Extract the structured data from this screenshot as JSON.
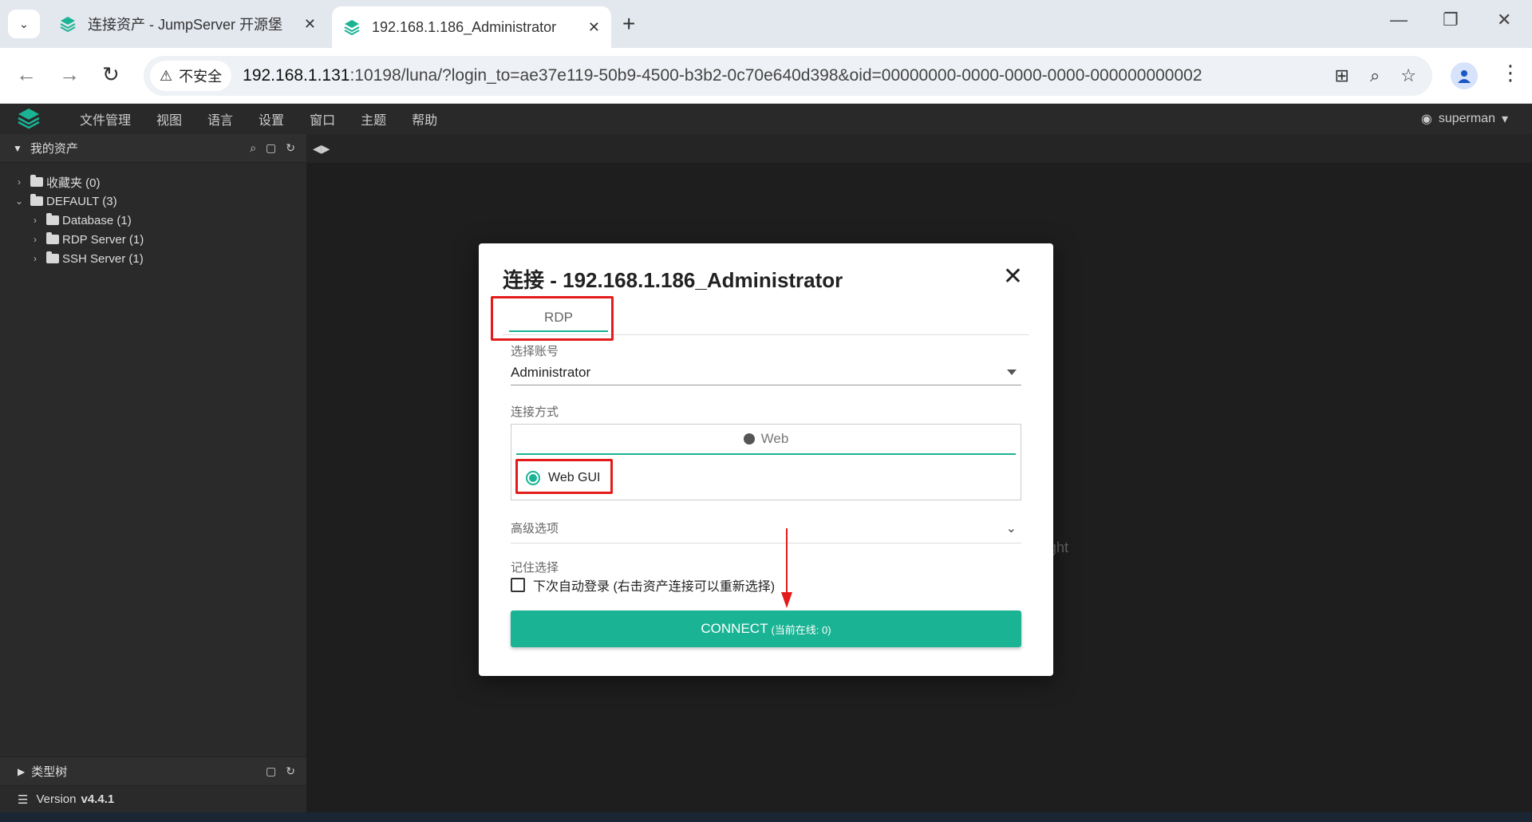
{
  "browser": {
    "tabs": [
      {
        "title": "连接资产 - JumpServer 开源堡",
        "active": false
      },
      {
        "title": "192.168.1.186_Administrator",
        "active": true
      }
    ],
    "security_label": "不安全",
    "url_host": "192.168.1.131",
    "url_rest": ":10198/luna/?login_to=ae37e119-50b9-4500-b3b2-0c70e640d398&oid=00000000-0000-0000-0000-000000000002"
  },
  "menubar": {
    "items": [
      "文件管理",
      "视图",
      "语言",
      "设置",
      "窗口",
      "主题",
      "帮助"
    ],
    "user": "superman"
  },
  "sidebar": {
    "header": "我的资产",
    "tree": [
      {
        "label": "收藏夹 (0)",
        "level": 0,
        "expanded": false
      },
      {
        "label": "DEFAULT (3)",
        "level": 0,
        "expanded": true
      },
      {
        "label": "Database (1)",
        "level": 1,
        "expanded": false
      },
      {
        "label": "RDP Server (1)",
        "level": 1,
        "expanded": false
      },
      {
        "label": "SSH Server (1)",
        "level": 1,
        "expanded": false
      }
    ],
    "type_tree_label": "类型树",
    "version_label": "Version",
    "version": "v4.4.1"
  },
  "main": {
    "bg_text": "ght"
  },
  "dialog": {
    "title": "连接 - 192.168.1.186_Administrator",
    "protocol_tab": "RDP",
    "account_label": "选择账号",
    "account_value": "Administrator",
    "method_label": "连接方式",
    "method_tab": "Web",
    "method_option": "Web GUI",
    "advanced_label": "高级选项",
    "remember_label": "记住选择",
    "auto_login_label": "下次自动登录 (右击资产连接可以重新选择)",
    "connect_label": "CONNECT",
    "connect_sub": "(当前在线: 0)"
  },
  "colors": {
    "accent": "#1ab394",
    "highlight": "#e31b1b"
  }
}
